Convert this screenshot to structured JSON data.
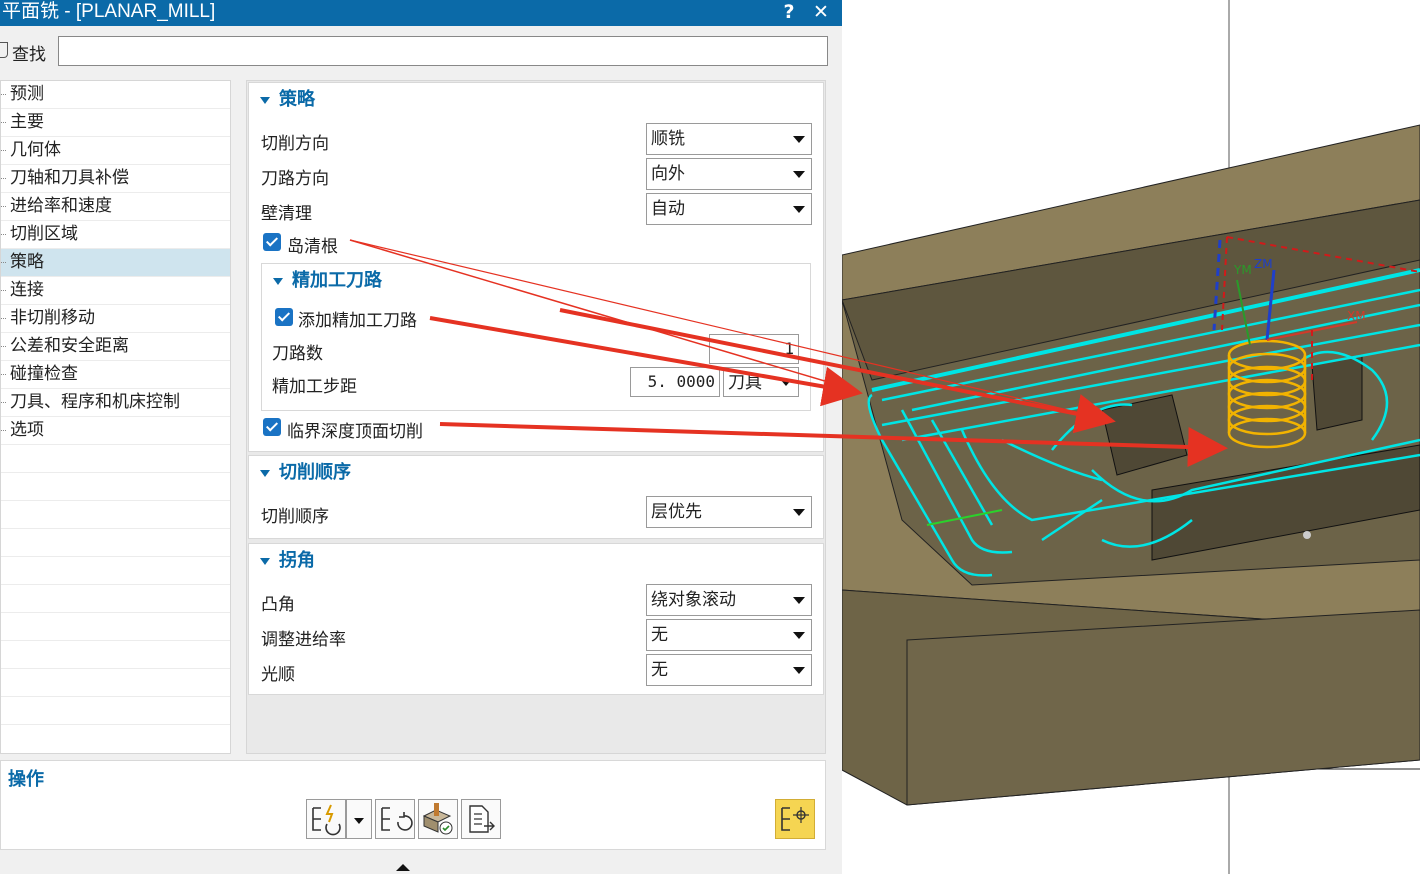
{
  "window": {
    "title": "平面铣 - [PLANAR_MILL]",
    "help": "?",
    "close": "✕"
  },
  "find": {
    "label": "查找",
    "value": ""
  },
  "nav": {
    "items": [
      {
        "label": "预测"
      },
      {
        "label": "主要"
      },
      {
        "label": "几何体"
      },
      {
        "label": "刀轴和刀具补偿"
      },
      {
        "label": "进给率和速度"
      },
      {
        "label": "切削区域"
      },
      {
        "label": "策略",
        "selected": true
      },
      {
        "label": "连接"
      },
      {
        "label": "非切削移动"
      },
      {
        "label": "公差和安全距离"
      },
      {
        "label": "碰撞检查"
      },
      {
        "label": "刀具、程序和机床控制"
      },
      {
        "label": "选项"
      }
    ]
  },
  "strategy": {
    "title": "策略",
    "cut_direction": {
      "label": "切削方向",
      "value": "顺铣"
    },
    "path_direction": {
      "label": "刀路方向",
      "value": "向外"
    },
    "wall_cleanup": {
      "label": "壁清理",
      "value": "自动"
    },
    "island_cleanup": {
      "label": "岛清根",
      "checked": true
    },
    "finish": {
      "title": "精加工刀路",
      "add_finish": {
        "label": "添加精加工刀路",
        "checked": true
      },
      "pass_count": {
        "label": "刀路数",
        "value": "1"
      },
      "stepover": {
        "label": "精加工步距",
        "value": "5. 0000",
        "unit": "刀具"
      }
    },
    "critical_depth": {
      "label": "临界深度顶面切削",
      "checked": true
    }
  },
  "cut_order": {
    "title": "切削顺序",
    "order": {
      "label": "切削顺序",
      "value": "层优先"
    }
  },
  "corners": {
    "title": "拐角",
    "convex": {
      "label": "凸角",
      "value": "绕对象滚动"
    },
    "feed_adjust": {
      "label": "调整进给率",
      "value": "无"
    },
    "smoothing": {
      "label": "光顺",
      "value": "无"
    }
  },
  "actions": {
    "title": "操作"
  },
  "viewport": {
    "axis_zm": "ZM",
    "axis_ym": "YM",
    "axis_xm": "XM"
  },
  "colors": {
    "accent": "#0b6aa8",
    "toolpath": "#00e5e5",
    "arrow": "#e53222",
    "tool": "#f2b300",
    "stock_top": "#8d7f5a",
    "stock_side": "#6e6447"
  }
}
